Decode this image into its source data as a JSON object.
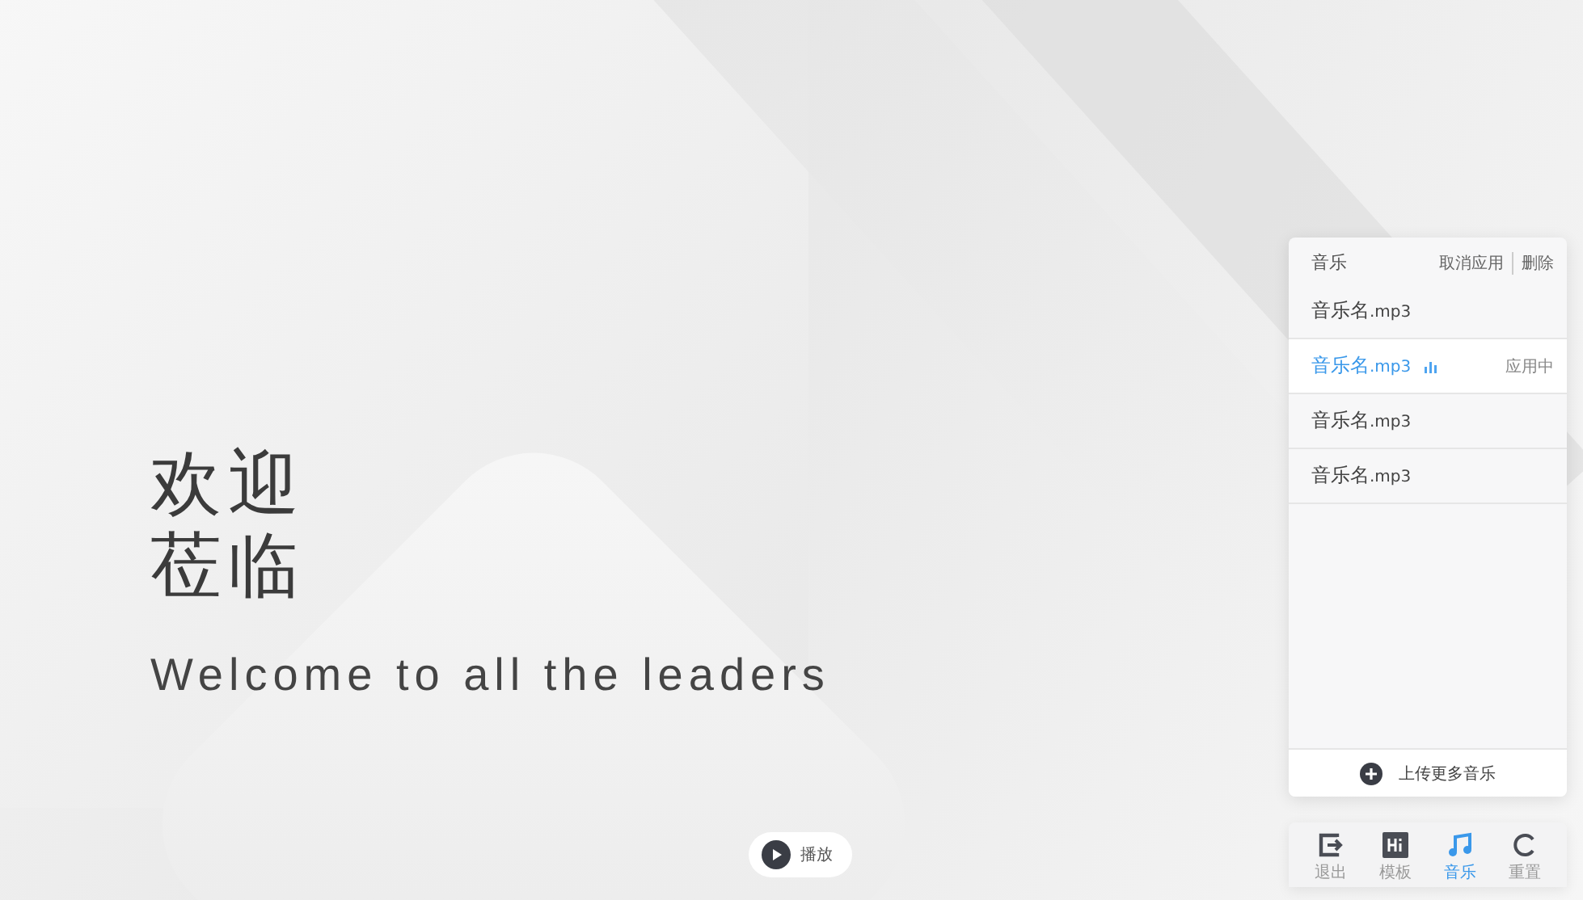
{
  "welcome": {
    "title_lines": [
      "欢迎",
      "莅临"
    ],
    "subtitle": "Welcome to all the leaders"
  },
  "play_button": {
    "label": "播放"
  },
  "music_panel": {
    "title": "音乐",
    "actions": [
      "取消应用",
      "删除"
    ],
    "items": [
      {
        "name": "音乐名",
        "ext": ".mp3",
        "selected": false
      },
      {
        "name": "音乐名",
        "ext": ".mp3",
        "selected": true,
        "status": "应用中"
      },
      {
        "name": "音乐名",
        "ext": ".mp3",
        "selected": false
      },
      {
        "name": "音乐名",
        "ext": ".mp3",
        "selected": false
      }
    ],
    "upload_label": "上传更多音乐"
  },
  "toolbar": [
    {
      "kind": "exit",
      "label": "退出",
      "selected": false
    },
    {
      "kind": "template",
      "label": "模板",
      "selected": false
    },
    {
      "kind": "music",
      "label": "音乐",
      "selected": true
    },
    {
      "kind": "reset",
      "label": "重置",
      "selected": false
    }
  ]
}
